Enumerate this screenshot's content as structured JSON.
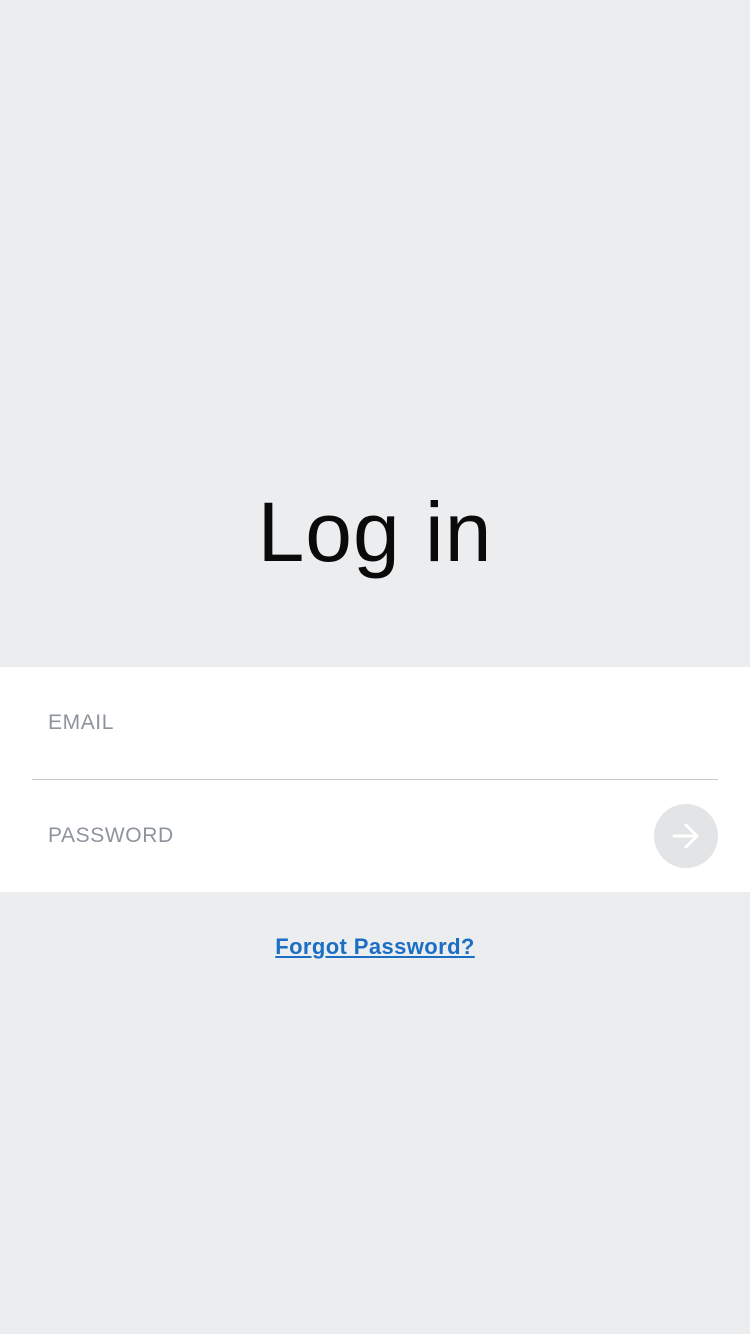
{
  "header": {
    "title": "Log in"
  },
  "form": {
    "email": {
      "placeholder": "EMAIL",
      "value": ""
    },
    "password": {
      "placeholder": "PASSWORD",
      "value": ""
    },
    "submit_icon": "arrow-right-icon"
  },
  "links": {
    "forgot_password": "Forgot Password?"
  },
  "colors": {
    "background": "#ecedef",
    "link": "#1a6fc4",
    "placeholder": "#8e949b",
    "submit_bg": "#e3e4e6"
  }
}
